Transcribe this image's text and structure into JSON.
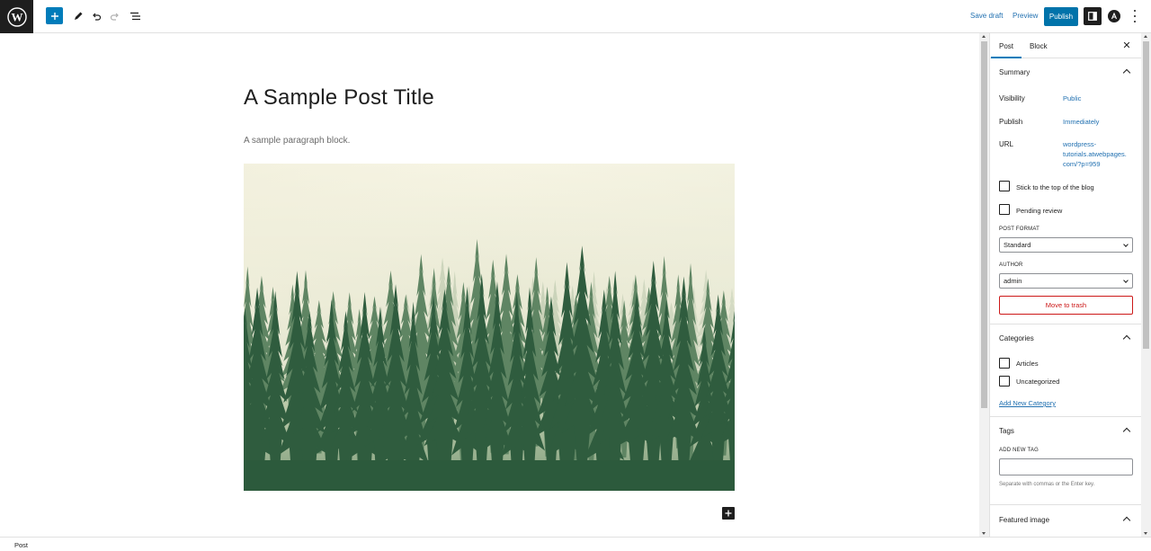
{
  "topbar": {
    "logo_icon": "wordpress-logo-icon",
    "add_block_icon": "plus-icon",
    "tools_icon": "pencil-icon",
    "undo_icon": "undo-icon",
    "redo_icon": "redo-icon",
    "outline_icon": "list-view-icon",
    "save_draft": "Save draft",
    "preview": "Preview",
    "publish": "Publish",
    "settings_icon": "sidebar-toggle-icon",
    "astra_icon": "astra-icon",
    "more_icon": "more-vertical-icon",
    "accent_color": "#0073aa"
  },
  "editor": {
    "title": "A Sample Post Title",
    "paragraph": "A sample paragraph block.",
    "image_subject": "foggy pine forest"
  },
  "sidebar": {
    "tabs": [
      {
        "label": "Post",
        "active": true
      },
      {
        "label": "Block",
        "active": false
      }
    ],
    "close_icon": "close-icon",
    "summary": {
      "heading": "Summary",
      "rows": [
        {
          "label": "Visibility",
          "value": "Public"
        },
        {
          "label": "Publish",
          "value": "Immediately"
        },
        {
          "label": "URL",
          "value": "wordpress-tutorials.atwebpages.com/?p=959"
        }
      ],
      "url_lines": [
        "wordpress-",
        "tutorials.atwebpages.",
        "com/?p=959"
      ],
      "stick_to_top": "Stick to the top of the blog",
      "pending_review": "Pending review",
      "post_format_label": "POST FORMAT",
      "post_format_value": "Standard",
      "author_label": "AUTHOR",
      "author_value": "admin",
      "trash": "Move to trash"
    },
    "categories": {
      "heading": "Categories",
      "items": [
        "Articles",
        "Uncategorized"
      ],
      "add_new": "Add New Category"
    },
    "tags": {
      "heading": "Tags",
      "add_label": "ADD NEW TAG",
      "help": "Separate with commas or the Enter key."
    },
    "featured_image": {
      "heading": "Featured image"
    }
  },
  "footer": {
    "breadcrumb": "Post"
  }
}
